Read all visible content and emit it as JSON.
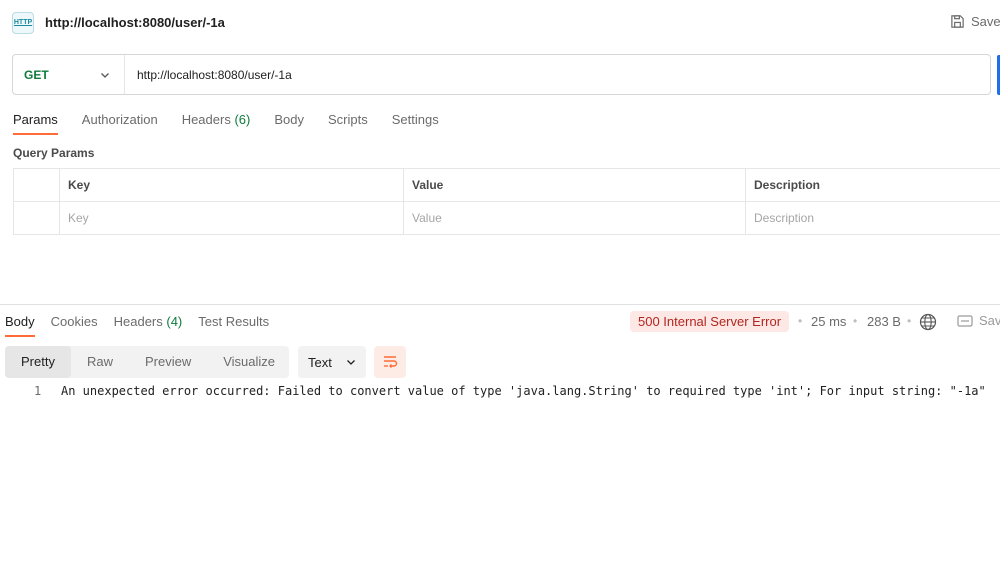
{
  "request": {
    "badge": "HTTP",
    "title": "http://localhost:8080/user/-1a",
    "save_label": "Save",
    "method": "GET",
    "url": "http://localhost:8080/user/-1a"
  },
  "request_tabs": {
    "params": "Params",
    "authorization": "Authorization",
    "headers": "Headers",
    "headers_count": "(6)",
    "body": "Body",
    "scripts": "Scripts",
    "settings": "Settings"
  },
  "query_params": {
    "label": "Query Params",
    "columns": [
      "Key",
      "Value",
      "Description"
    ],
    "placeholders": [
      "Key",
      "Value",
      "Description"
    ]
  },
  "response_tabs": {
    "body": "Body",
    "cookies": "Cookies",
    "headers": "Headers",
    "headers_count": "(4)",
    "test_results": "Test Results"
  },
  "response": {
    "status": "500 Internal Server Error",
    "time": "25 ms",
    "size": "283 B",
    "save_label": "Sav",
    "views": [
      "Pretty",
      "Raw",
      "Preview",
      "Visualize"
    ],
    "format": "Text",
    "line_number": "1",
    "body_text": "An unexpected error occurred: Failed to convert value of type 'java.lang.String' to required type 'int'; For input string: \"-1a\""
  },
  "colors": {
    "accent": "#ff6c37",
    "method_get": "#0f7b3c",
    "error": "#b3261e"
  }
}
